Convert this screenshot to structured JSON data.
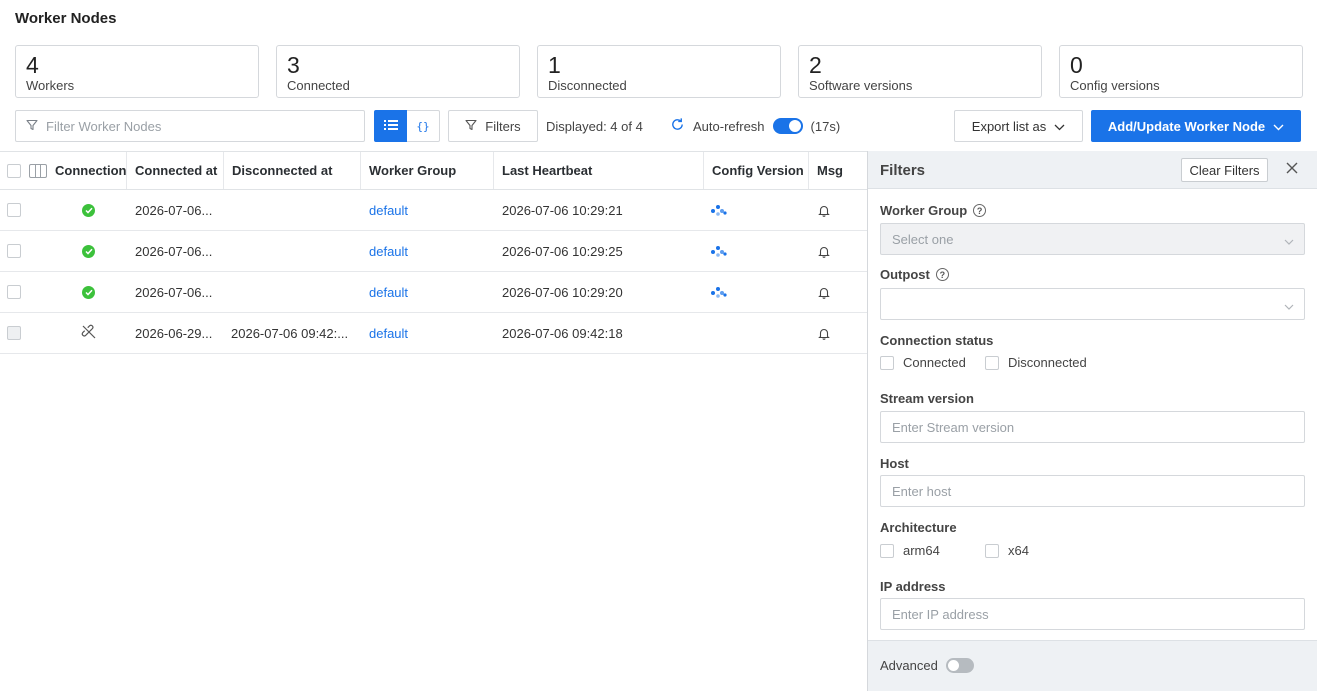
{
  "page": {
    "title": "Worker Nodes"
  },
  "stats": [
    {
      "value": "4",
      "label": "Workers"
    },
    {
      "value": "3",
      "label": "Connected"
    },
    {
      "value": "1",
      "label": "Disconnected"
    },
    {
      "value": "2",
      "label": "Software versions"
    },
    {
      "value": "0",
      "label": "Config versions"
    }
  ],
  "toolbar": {
    "search_placeholder": "Filter Worker Nodes",
    "list_view_icon": "list-icon",
    "json_view_label": "{}",
    "filters_label": "Filters",
    "displayed": "Displayed: 4 of 4",
    "autorefresh_label": "Auto-refresh",
    "autorefresh_on": true,
    "autorefresh_countdown": "(17s)",
    "export_label": "Export list as",
    "add_label": "Add/Update Worker Node"
  },
  "table": {
    "columns": [
      "Connection",
      "Connected at",
      "Disconnected at",
      "Worker Group",
      "Last Heartbeat",
      "Config Version",
      "Msg"
    ],
    "rows": [
      {
        "status": "connected",
        "connected_at": "2026-07-06...",
        "disconnected_at": "",
        "worker_group": "default",
        "last_heartbeat": "2026-07-06 10:29:21",
        "config_icon": "loading-dots-icon",
        "msg_icon": "bell-icon"
      },
      {
        "status": "connected",
        "connected_at": "2026-07-06...",
        "disconnected_at": "",
        "worker_group": "default",
        "last_heartbeat": "2026-07-06 10:29:25",
        "config_icon": "loading-dots-icon",
        "msg_icon": "bell-icon"
      },
      {
        "status": "connected",
        "connected_at": "2026-07-06...",
        "disconnected_at": "",
        "worker_group": "default",
        "last_heartbeat": "2026-07-06 10:29:20",
        "config_icon": "loading-dots-icon",
        "msg_icon": "bell-icon"
      },
      {
        "status": "disconnected",
        "connected_at": "2026-06-29...",
        "disconnected_at": "2026-07-06 09:42:...",
        "worker_group": "default",
        "last_heartbeat": "2026-07-06 09:42:18",
        "config_icon": "",
        "msg_icon": "bell-icon"
      }
    ]
  },
  "filters_panel": {
    "title": "Filters",
    "clear_label": "Clear Filters",
    "worker_group": {
      "label": "Worker Group",
      "placeholder": "Select one"
    },
    "outpost": {
      "label": "Outpost",
      "value": ""
    },
    "connection_status": {
      "label": "Connection status",
      "options": [
        "Connected",
        "Disconnected"
      ]
    },
    "stream_version": {
      "label": "Stream version",
      "placeholder": "Enter Stream version"
    },
    "host": {
      "label": "Host",
      "placeholder": "Enter host"
    },
    "architecture": {
      "label": "Architecture",
      "options": [
        "arm64",
        "x64"
      ]
    },
    "ip_address": {
      "label": "IP address",
      "placeholder": "Enter IP address"
    },
    "advanced_label": "Advanced",
    "advanced_on": false
  },
  "colors": {
    "accent": "#1a73e8",
    "success": "#3cc13b",
    "panel_bg": "#eef1f4"
  }
}
